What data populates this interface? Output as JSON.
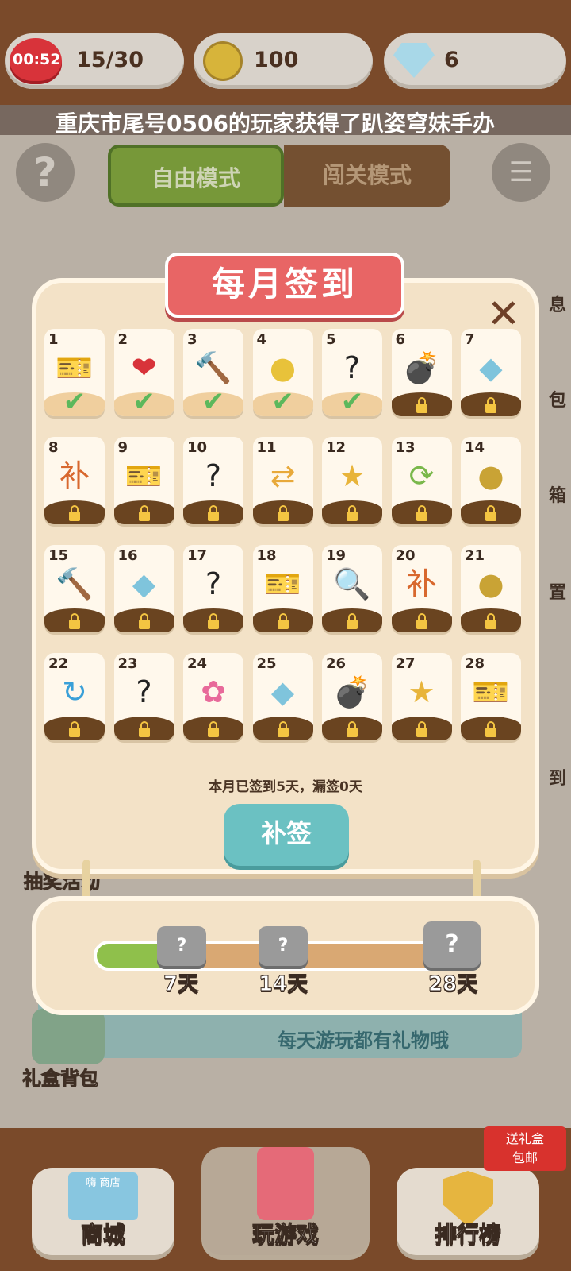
{
  "status_bar": {
    "timer": "00:52",
    "lives": "15/30",
    "coins": "100",
    "gems": "6"
  },
  "ticker": "重庆市尾号0506的玩家获得了趴姿穹妹手办",
  "modes": {
    "free": "自由模式",
    "level": "闯关模式"
  },
  "side_labels": [
    "息",
    "包",
    "箱",
    "置",
    "到"
  ],
  "background": {
    "lottery": "抽奖活动",
    "gift_bag": "礼盒背包",
    "hint": "每天游玩都有礼物哦"
  },
  "signin": {
    "title": "每月签到",
    "close": "✕",
    "days": [
      {
        "n": "1",
        "icon": "ticket-icon",
        "claimed": true
      },
      {
        "n": "2",
        "icon": "heart-icon",
        "claimed": true
      },
      {
        "n": "3",
        "icon": "hammer-icon",
        "claimed": true
      },
      {
        "n": "4",
        "icon": "bomb-gold-icon",
        "claimed": true
      },
      {
        "n": "5",
        "icon": "mystery-block-icon",
        "claimed": true
      },
      {
        "n": "6",
        "icon": "bomb-icon",
        "claimed": false
      },
      {
        "n": "7",
        "icon": "gem-icon",
        "claimed": false
      },
      {
        "n": "8",
        "icon": "makeup-card-icon",
        "claimed": false
      },
      {
        "n": "9",
        "icon": "ticket-icon",
        "claimed": false
      },
      {
        "n": "10",
        "icon": "mystery-block-icon",
        "claimed": false
      },
      {
        "n": "11",
        "icon": "shuffle-icon",
        "claimed": false
      },
      {
        "n": "12",
        "icon": "star-wand-icon",
        "claimed": false
      },
      {
        "n": "13",
        "icon": "swap-icon",
        "claimed": false
      },
      {
        "n": "14",
        "icon": "coin-icon",
        "claimed": false
      },
      {
        "n": "15",
        "icon": "hammer-icon",
        "claimed": false
      },
      {
        "n": "16",
        "icon": "gem-icon",
        "claimed": false
      },
      {
        "n": "17",
        "icon": "mystery-block-icon",
        "claimed": false
      },
      {
        "n": "18",
        "icon": "ticket-icon",
        "claimed": false
      },
      {
        "n": "19",
        "icon": "magnifier-icon",
        "claimed": false
      },
      {
        "n": "20",
        "icon": "makeup-card-icon",
        "claimed": false
      },
      {
        "n": "21",
        "icon": "coin-icon",
        "claimed": false
      },
      {
        "n": "22",
        "icon": "refresh-icon",
        "claimed": false
      },
      {
        "n": "23",
        "icon": "mystery-block-icon",
        "claimed": false
      },
      {
        "n": "24",
        "icon": "flower-icon",
        "claimed": false
      },
      {
        "n": "25",
        "icon": "gem-icon",
        "claimed": false
      },
      {
        "n": "26",
        "icon": "bomb-icon",
        "claimed": false
      },
      {
        "n": "27",
        "icon": "star-wand-icon",
        "claimed": false
      },
      {
        "n": "28",
        "icon": "ticket-icon",
        "claimed": false
      }
    ],
    "summary": "本月已签到5天，漏签0天",
    "makeup_button": "补签"
  },
  "progress": {
    "milestones": [
      "7天",
      "14天",
      "28天"
    ],
    "fraction": 0.18
  },
  "nav": {
    "shop": "商城",
    "shop_sign": "嗨 商店",
    "play": "玩游戏",
    "rank": "排行榜",
    "gift_badge_line1": "送礼盒",
    "gift_badge_line2": "包邮"
  },
  "colors": {
    "accent_green": "#8fc04b",
    "accent_red": "#e86565",
    "accent_teal": "#6bc1c2",
    "wood": "#7a4a2a"
  }
}
